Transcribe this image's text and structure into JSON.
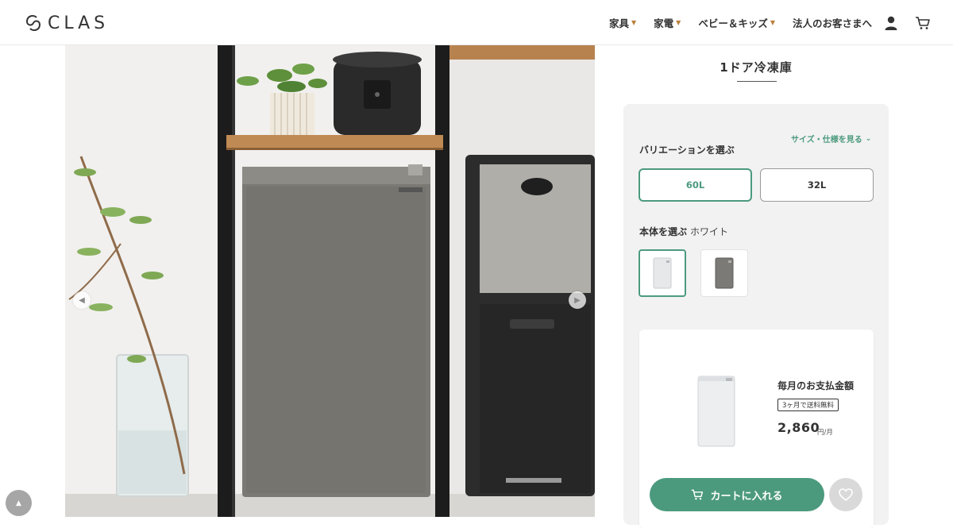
{
  "brand": {
    "name": "CLAS"
  },
  "nav": {
    "items": [
      {
        "label": "家具"
      },
      {
        "label": "家電"
      },
      {
        "label": "ベビー＆キッズ"
      },
      {
        "label": "法人のお客さまへ"
      }
    ],
    "icons": [
      "user-icon",
      "cart-icon"
    ]
  },
  "product": {
    "title": "1ドア冷凍庫",
    "spec_link": "サイズ・仕様を見る",
    "variation_label": "バリエーションを選ぶ",
    "variations": [
      {
        "label": "60L",
        "selected": true
      },
      {
        "label": "32L",
        "selected": false
      }
    ],
    "body_label": "本体を選ぶ",
    "body_value": "ホワイト",
    "swatches": [
      {
        "name": "white",
        "selected": true
      },
      {
        "name": "silver",
        "selected": false
      }
    ]
  },
  "purchase": {
    "monthly_label": "毎月のお支払金額",
    "badge": "3ヶ月で送料無料",
    "price": "2,860",
    "price_unit": "円/月",
    "cart_label": "カートに入れる"
  },
  "colors": {
    "accent": "#4c9a7e",
    "caret": "#b9803c",
    "panel_bg": "#f2f2f2"
  }
}
